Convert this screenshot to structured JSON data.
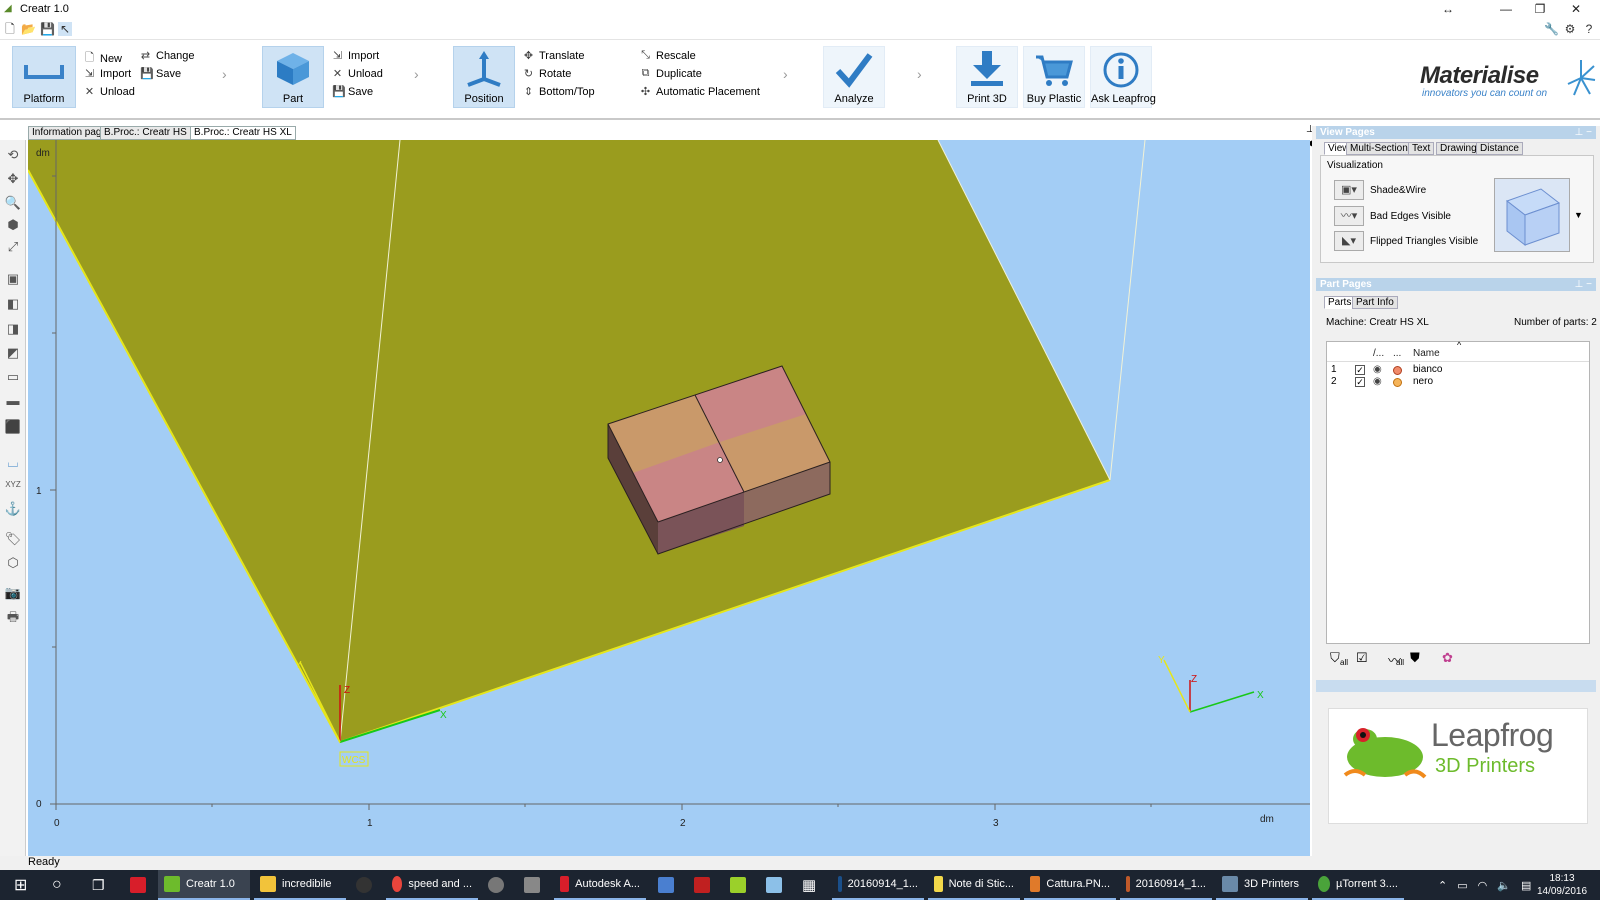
{
  "window": {
    "title": "Creatr 1.0"
  },
  "ribbon": {
    "platform_label": "Platform",
    "platform_menu": {
      "new": "New",
      "import": "Import",
      "unload": "Unload",
      "change": "Change",
      "save": "Save"
    },
    "part_label": "Part",
    "part_menu": {
      "import": "Import",
      "unload": "Unload",
      "save": "Save"
    },
    "position_label": "Position",
    "position_menu": {
      "translate": "Translate",
      "rotate": "Rotate",
      "bottom_top": "Bottom/Top",
      "rescale": "Rescale",
      "duplicate": "Duplicate",
      "automatic_placement": "Automatic Placement"
    },
    "analyze_label": "Analyze",
    "print3d_label": "Print 3D",
    "buy_plastic_label": "Buy Plastic",
    "ask_leapfrog_label": "Ask Leapfrog"
  },
  "logo": {
    "name": "Materialise",
    "tagline": "innovators you can count on"
  },
  "view_tabs": [
    "Information page",
    "B.Proc.: Creatr HS XL",
    "B.Proc.: Creatr HS XL"
  ],
  "viewport": {
    "unit_top": "dm",
    "unit_bottom": "dm",
    "ruler_y": [
      "1",
      "0"
    ],
    "ruler_x": [
      "0",
      "1",
      "2",
      "3"
    ],
    "wcs_label": "WCS",
    "axis_labels": {
      "x": "X",
      "y": "Y",
      "z": "Z"
    }
  },
  "status": {
    "text": "Ready"
  },
  "view_pages": {
    "title": "View Pages",
    "tabs": [
      "View",
      "Multi-Section",
      "Text",
      "Drawing",
      "Distance"
    ],
    "group_label": "Visualization",
    "options": [
      "Shade&Wire",
      "Bad Edges Visible",
      "Flipped Triangles Visible"
    ]
  },
  "part_pages": {
    "title": "Part Pages",
    "tabs": [
      "Parts",
      "Part Info"
    ],
    "machine": "Machine: Creatr HS XL",
    "count": "Number of parts: 2",
    "columns": [
      "/...",
      "...",
      "Name"
    ],
    "rows": [
      {
        "index": "1",
        "name": "bianco",
        "color": "#f08a6a"
      },
      {
        "index": "2",
        "name": "nero",
        "color": "#f5b45a"
      }
    ],
    "footer_labels": [
      "all",
      "all"
    ]
  },
  "leapfrog": {
    "brand": "Leapfrog",
    "subtitle": "3D Printers"
  },
  "taskbar": {
    "items": [
      "Creatr 1.0",
      "incredibile",
      "speed and ...",
      "Autodesk A...",
      "20160914_1...",
      "Note di Stic...",
      "Cattura.PN...",
      "20160914_1...",
      "3D Printers",
      "µTorrent 3...."
    ],
    "clock_time": "18:13",
    "clock_date": "14/09/2016"
  },
  "colors": {
    "viewport_bg": "#a3cdf5",
    "platform": "#9a9c1e",
    "ribbon_active": "#cfe3f5",
    "panel_header": "#b9d3ea",
    "taskbar": "#1c2430"
  }
}
